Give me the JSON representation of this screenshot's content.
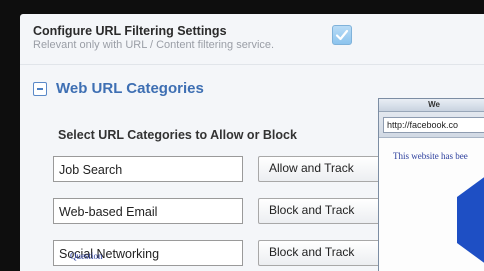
{
  "settings": {
    "title": "Configure URL Filtering Settings",
    "subtitle": "Relevant only with URL / Content filtering service.",
    "enabled": true
  },
  "section": {
    "title": "Web URL Categories",
    "select_heading": "Select URL Categories to Allow or Block"
  },
  "categories": [
    {
      "name": "Job Search",
      "action": "Allow and Track"
    },
    {
      "name": "Web-based Email",
      "action": "Block and Track"
    },
    {
      "name": "Social Networking",
      "action": "Block and Track"
    }
  ],
  "browser": {
    "title": "We",
    "url": "http://facebook.co",
    "message": "This website has bee",
    "footer_text": "Question",
    "accent_color": "#1e4fc4"
  },
  "colors": {
    "section_title": "#3e6fb3",
    "checkbox": "#8cc4ee",
    "background": "#0e0e0e"
  }
}
